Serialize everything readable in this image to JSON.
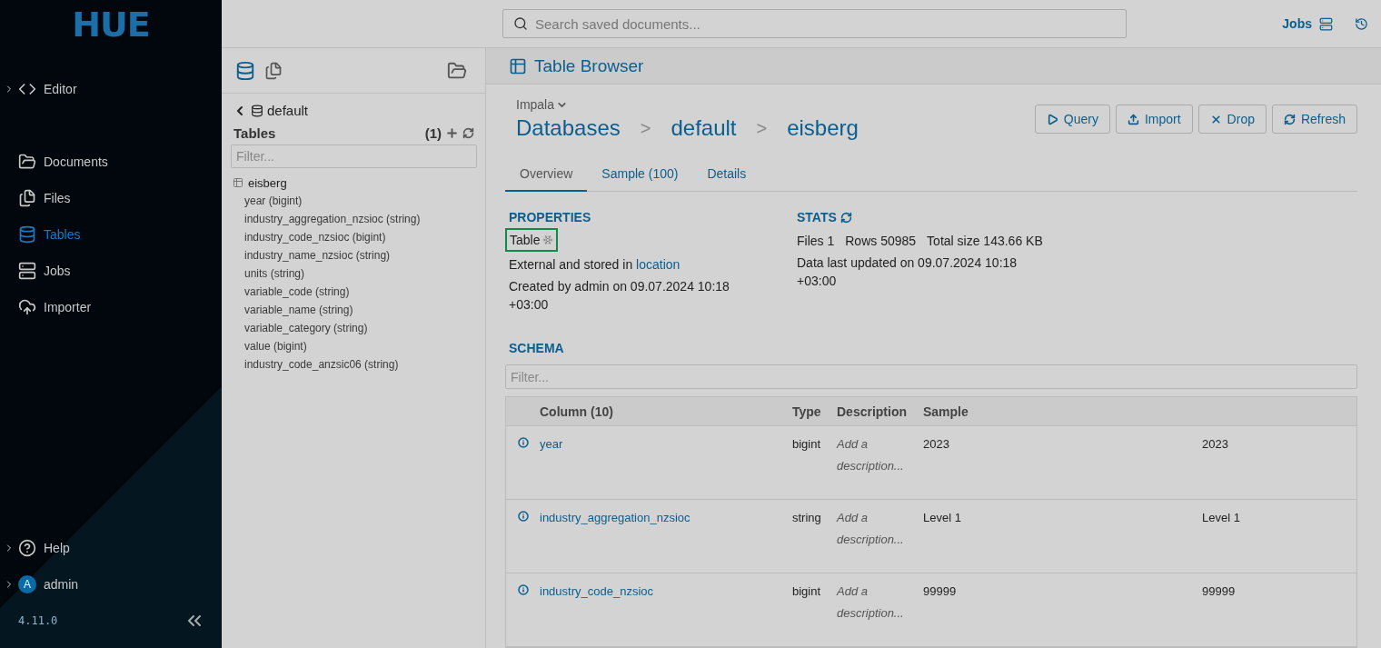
{
  "logo": {
    "text": "HUE"
  },
  "sidebar": {
    "items": [
      {
        "label": "Editor",
        "expandable": true,
        "selected": false
      }
    ],
    "apps": [
      {
        "label": "Documents",
        "selected": false
      },
      {
        "label": "Files",
        "selected": false
      },
      {
        "label": "Tables",
        "selected": true
      },
      {
        "label": "Jobs",
        "selected": false
      },
      {
        "label": "Importer",
        "selected": false
      }
    ],
    "bottom": [
      {
        "label": "Help",
        "kind": "help"
      },
      {
        "label": "admin",
        "kind": "user",
        "avatar": "A"
      }
    ],
    "version": "4.11.0"
  },
  "topbar": {
    "search": {
      "placeholder": "Search saved documents..."
    },
    "jobs": "Jobs"
  },
  "assist": {
    "database": "default",
    "section": "Tables",
    "count": "(1)",
    "filter": {
      "placeholder": "Filter..."
    },
    "tree": [
      {
        "label": "eisberg",
        "children": [
          {
            "label": "year (bigint)"
          },
          {
            "label": "industry_aggregation_nzsioc (string)"
          },
          {
            "label": "industry_code_nzsioc (bigint)"
          },
          {
            "label": "industry_name_nzsioc (string)"
          },
          {
            "label": "units (string)"
          },
          {
            "label": "variable_code (string)"
          },
          {
            "label": "variable_name (string)"
          },
          {
            "label": "variable_category (string)"
          },
          {
            "label": "value (bigint)"
          },
          {
            "label": "industry_code_anzsic06 (string)"
          }
        ]
      }
    ]
  },
  "page": {
    "title": "Table Browser",
    "engine": "Impala",
    "breadcrumbs": [
      "Databases",
      "default",
      "eisberg"
    ],
    "separator": ">",
    "buttons": [
      "Query",
      "Import",
      "Drop",
      "Refresh"
    ],
    "tabs": [
      {
        "label": "Overview",
        "selected": true
      },
      {
        "label": "Sample (100)",
        "selected": false
      },
      {
        "label": "Details",
        "selected": false
      }
    ],
    "properties": {
      "heading": "PROPERTIES",
      "type": "Table",
      "highlighted": true,
      "storage_text": "External and stored in",
      "storage_link": "location",
      "created": "Created by admin on 09.07.2024 10:18 +03:00"
    },
    "stats": {
      "heading": "STATS",
      "items": [
        {
          "label": "Files",
          "value": "1"
        },
        {
          "label": "Rows",
          "value": "50985"
        },
        {
          "label": "Total size",
          "value": "143.66 KB"
        }
      ],
      "updated": "Data last updated on 09.07.2024 10:18 +03:00"
    },
    "schema": {
      "heading": "SCHEMA",
      "filter": {
        "placeholder": "Filter..."
      },
      "columns": [
        "Column (10)",
        "Type",
        "Description",
        "Sample"
      ],
      "rows": [
        {
          "name": "year",
          "type": "bigint",
          "description": "Add a description...",
          "sample": "2023",
          "column_5": "2023"
        },
        {
          "name": "industry_aggregation_nzsioc",
          "type": "string",
          "description": "Add a description...",
          "sample": "Level 1",
          "column_5": "Level 1"
        },
        {
          "name": "industry_code_nzsioc",
          "type": "bigint",
          "description": "Add a description...",
          "sample": "99999",
          "column_5": "99999"
        }
      ]
    }
  }
}
